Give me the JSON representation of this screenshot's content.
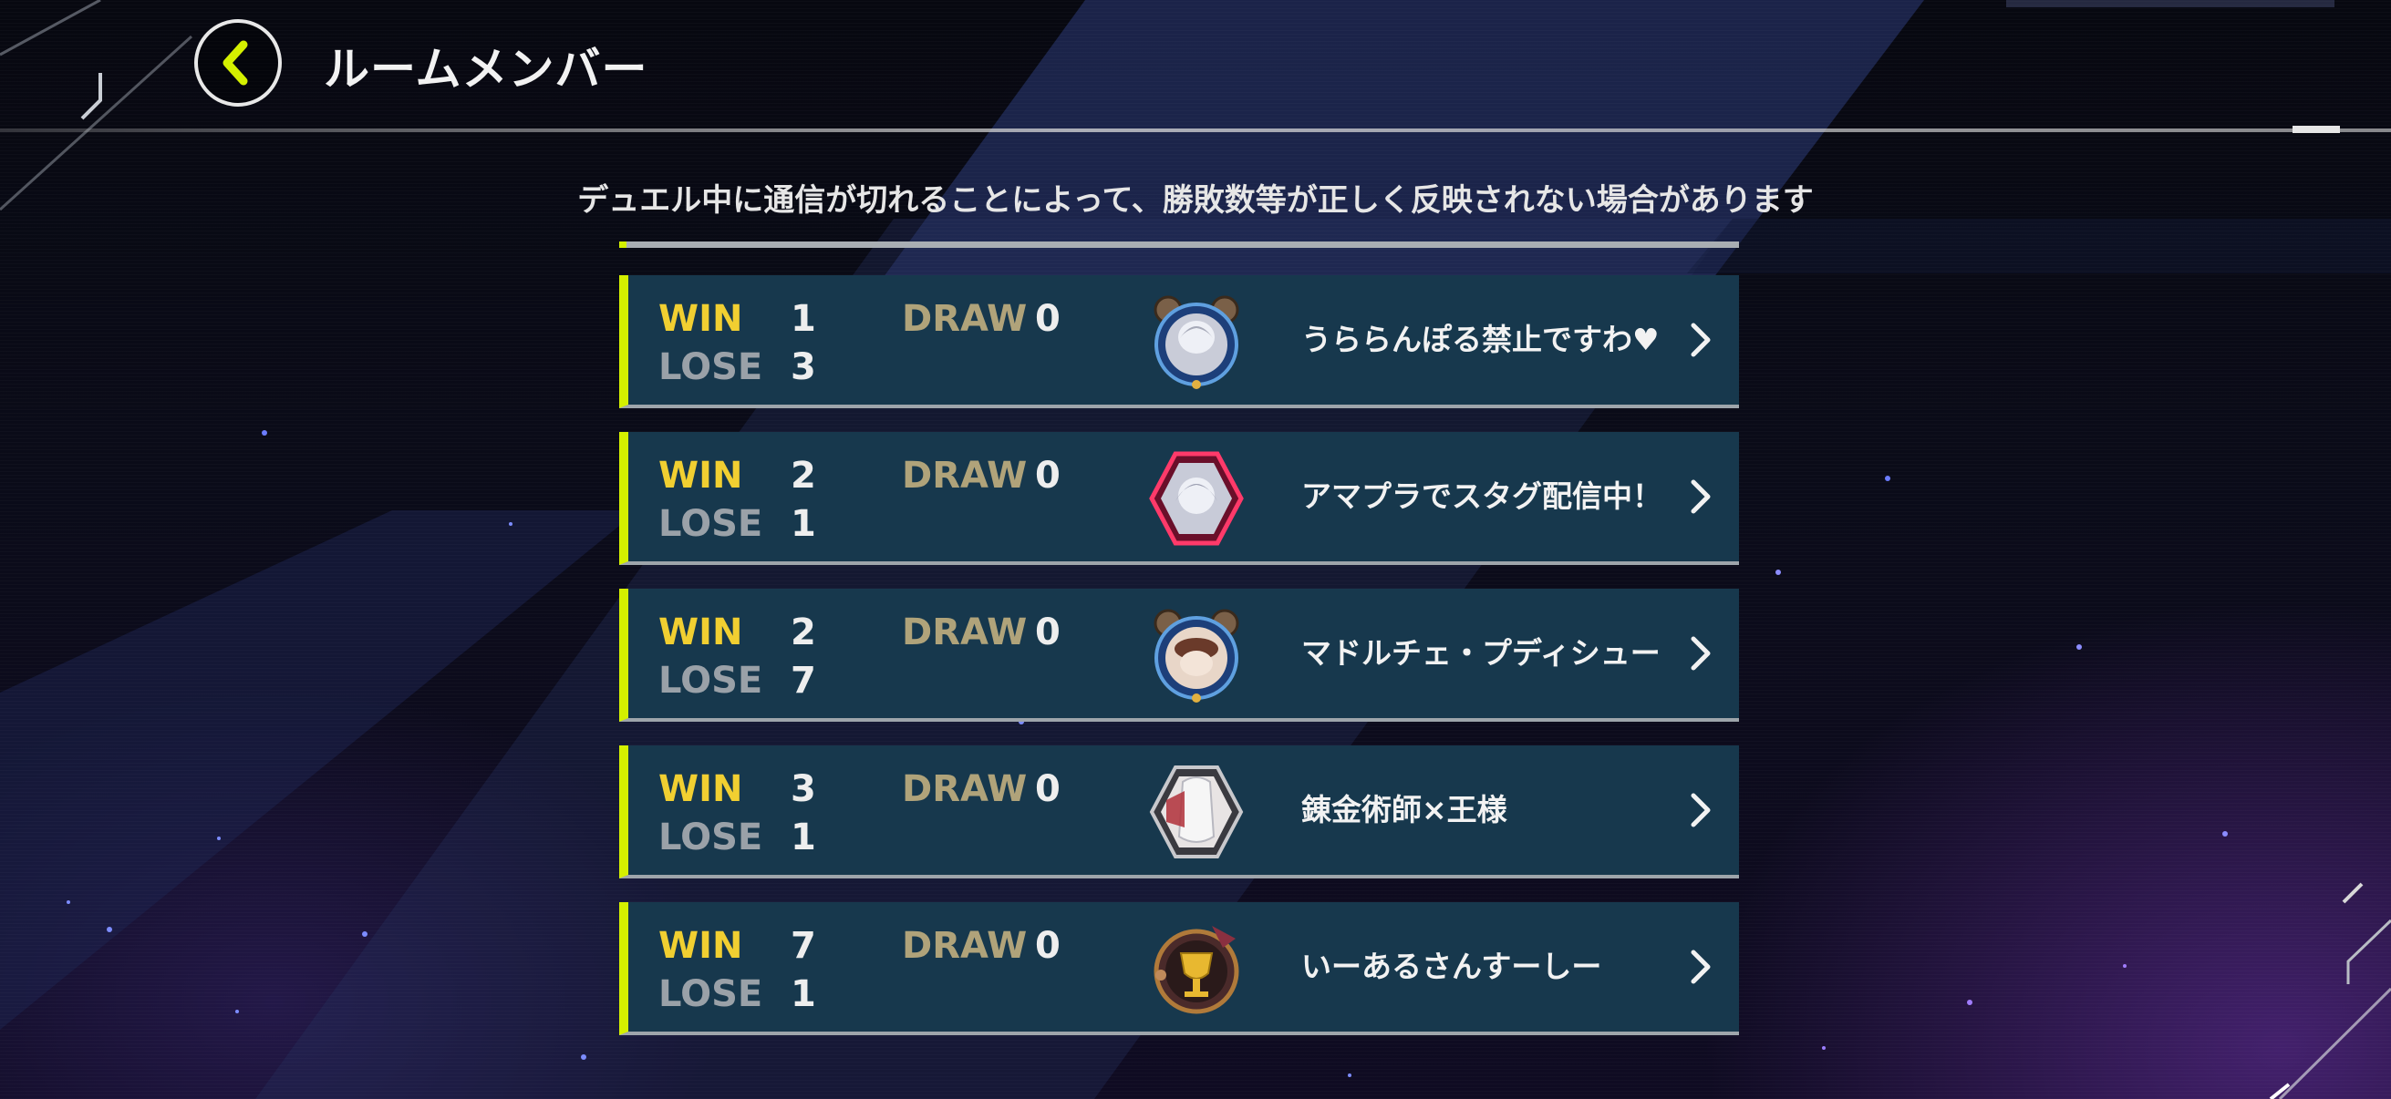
{
  "header": {
    "title": "ルームメンバー",
    "back_icon": "chevron-left-icon"
  },
  "notice": "デュエル中に通信が切れることによって、勝敗数等が正しく反映されない場合があります",
  "labels": {
    "win": "WIN",
    "lose": "LOSE",
    "draw": "DRAW"
  },
  "colors": {
    "accent": "#d4f000",
    "win_label": "#f1cf31",
    "row_background": "#17384d"
  },
  "members": [
    {
      "win": "1",
      "lose": "3",
      "draw": "0",
      "name": "うららんぽる禁止ですわ♥",
      "avatar_icon": "avatar-icon"
    },
    {
      "win": "2",
      "lose": "1",
      "draw": "0",
      "name": "アマプラでスタグ配信中！",
      "avatar_icon": "avatar-icon"
    },
    {
      "win": "2",
      "lose": "7",
      "draw": "0",
      "name": "マドルチェ・プディシュー",
      "avatar_icon": "avatar-icon"
    },
    {
      "win": "3",
      "lose": "1",
      "draw": "0",
      "name": "錬金術師×王様",
      "avatar_icon": "avatar-icon"
    },
    {
      "win": "7",
      "lose": "1",
      "draw": "0",
      "name": "いーあるさんすーしー",
      "avatar_icon": "avatar-icon"
    }
  ]
}
